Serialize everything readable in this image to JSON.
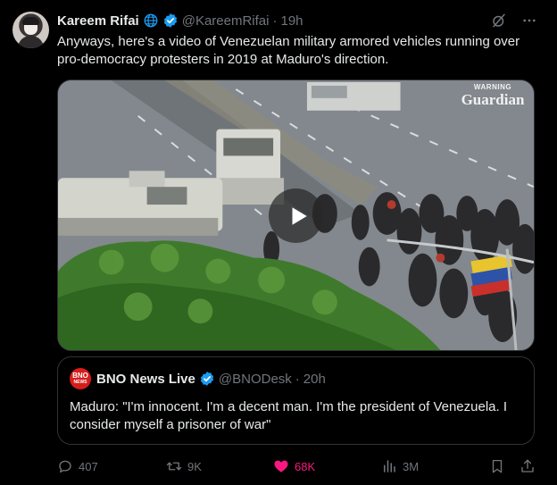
{
  "tweet": {
    "author_name": "Kareem Rifai",
    "handle": "@KareemRifai",
    "separator": "·",
    "time": "19h",
    "text": "Anyways, here's a video of Venezuelan military armored vehicles running over pro-democracy protesters in 2019 at Maduro's direction.",
    "icons": {
      "affiliation": "globe-icon",
      "verified": "verified-badge-icon",
      "grok": "grok-icon",
      "more": "more-icon"
    }
  },
  "media": {
    "type": "video",
    "watermark_line1": "WARNING",
    "watermark_line2": "Guardian",
    "play_icon": "play-icon"
  },
  "quote": {
    "avatar_line1": "BNO",
    "avatar_line2": "NEWS",
    "name": "BNO News Live",
    "handle": "@BNODesk",
    "separator": "·",
    "time": "20h",
    "text": "Maduro: \"I'm innocent. I'm a decent man. I'm the president of Venezuela. I consider myself a prisoner of war\""
  },
  "actions": {
    "replies": "407",
    "reposts": "9K",
    "likes": "68K",
    "views": "3M"
  },
  "colors": {
    "background": "#000000",
    "text": "#e7e9ea",
    "muted": "#71767b",
    "verified": "#1d9bf0",
    "like": "#f91880",
    "border": "#2f3336",
    "bno_red": "#d71c1c"
  }
}
